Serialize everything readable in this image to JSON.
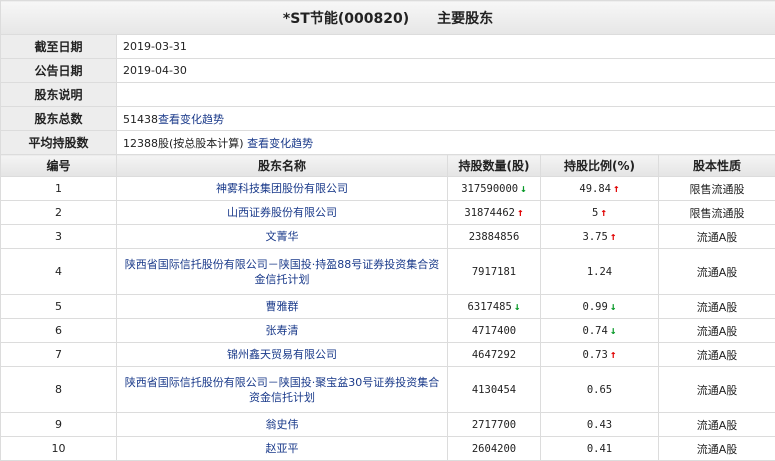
{
  "title": {
    "name": "*ST节能(000820)",
    "suffix": "主要股东"
  },
  "info": [
    {
      "label": "截至日期",
      "value": "2019-03-31",
      "link": ""
    },
    {
      "label": "公告日期",
      "value": "2019-04-30",
      "link": ""
    },
    {
      "label": "股东说明",
      "value": "",
      "link": ""
    },
    {
      "label": "股东总数",
      "value": "51438",
      "link": "查看变化趋势"
    },
    {
      "label": "平均持股数",
      "value": "12388股(按总股本计算)",
      "link": "查看变化趋势"
    }
  ],
  "columns": [
    "编号",
    "股东名称",
    "持股数量(股)",
    "持股比例(%)",
    "股本性质"
  ],
  "rows": [
    {
      "no": "1",
      "name": "神雾科技集团股份有限公司",
      "shares": "317590000",
      "shares_trend": "down",
      "ratio": "49.84",
      "ratio_trend": "up",
      "nature": "限售流通股"
    },
    {
      "no": "2",
      "name": "山西证券股份有限公司",
      "shares": "31874462",
      "shares_trend": "up",
      "ratio": "5",
      "ratio_trend": "up",
      "nature": "限售流通股"
    },
    {
      "no": "3",
      "name": "文菁华",
      "shares": "23884856",
      "shares_trend": "",
      "ratio": "3.75",
      "ratio_trend": "up",
      "nature": "流通A股"
    },
    {
      "no": "4",
      "name": "陕西省国际信托股份有限公司－陕国投·持盈88号证券投资集合资金信托计划",
      "shares": "7917181",
      "shares_trend": "",
      "ratio": "1.24",
      "ratio_trend": "",
      "nature": "流通A股"
    },
    {
      "no": "5",
      "name": "曹雅群",
      "shares": "6317485",
      "shares_trend": "down",
      "ratio": "0.99",
      "ratio_trend": "down",
      "nature": "流通A股"
    },
    {
      "no": "6",
      "name": "张寿清",
      "shares": "4717400",
      "shares_trend": "",
      "ratio": "0.74",
      "ratio_trend": "down",
      "nature": "流通A股"
    },
    {
      "no": "7",
      "name": "锦州鑫天贸易有限公司",
      "shares": "4647292",
      "shares_trend": "",
      "ratio": "0.73",
      "ratio_trend": "up",
      "nature": "流通A股"
    },
    {
      "no": "8",
      "name": "陕西省国际信托股份有限公司－陕国投·聚宝盆30号证券投资集合资金信托计划",
      "shares": "4130454",
      "shares_trend": "",
      "ratio": "0.65",
      "ratio_trend": "",
      "nature": "流通A股"
    },
    {
      "no": "9",
      "name": "翁史伟",
      "shares": "2717700",
      "shares_trend": "",
      "ratio": "0.43",
      "ratio_trend": "",
      "nature": "流通A股"
    },
    {
      "no": "10",
      "name": "赵亚平",
      "shares": "2604200",
      "shares_trend": "",
      "ratio": "0.41",
      "ratio_trend": "",
      "nature": "流通A股"
    }
  ],
  "colors": {
    "link": "#1a3a8a",
    "up": "#e00000",
    "down": "#0a9a2a"
  },
  "icons": {
    "up": "arrow-up-icon",
    "down": "arrow-down-icon"
  }
}
